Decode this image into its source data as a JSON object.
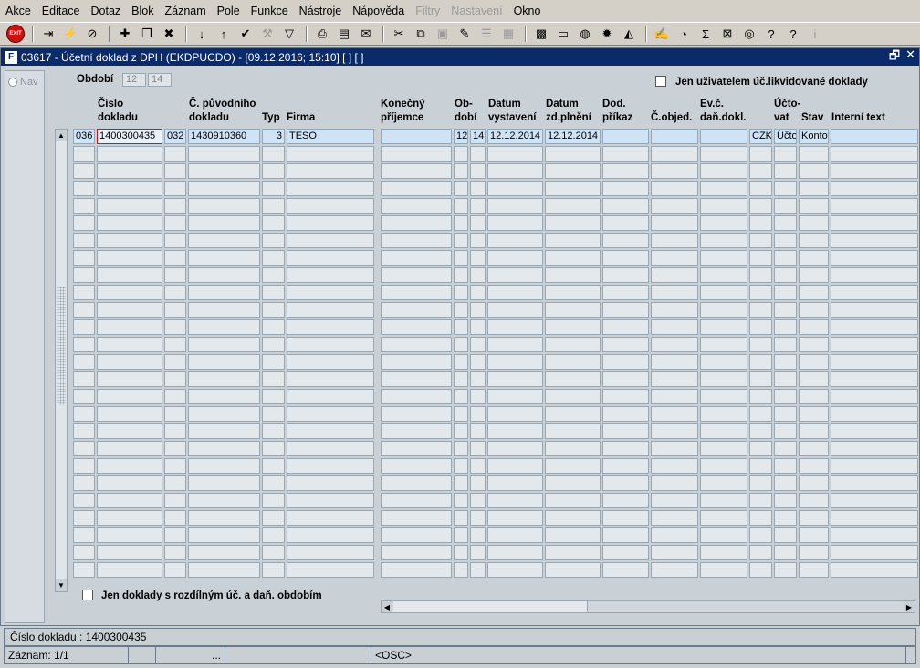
{
  "menu": [
    {
      "label": "Akce",
      "enabled": true
    },
    {
      "label": "Editace",
      "enabled": true
    },
    {
      "label": "Dotaz",
      "enabled": true
    },
    {
      "label": "Blok",
      "enabled": true
    },
    {
      "label": "Záznam",
      "enabled": true
    },
    {
      "label": "Pole",
      "enabled": true
    },
    {
      "label": "Funkce",
      "enabled": true
    },
    {
      "label": "Nástroje",
      "enabled": true
    },
    {
      "label": "Nápověda",
      "enabled": true
    },
    {
      "label": "Filtry",
      "enabled": false
    },
    {
      "label": "Nastavení",
      "enabled": false
    },
    {
      "label": "Okno",
      "enabled": true
    }
  ],
  "toolbar": {
    "exit_label": "EXIT",
    "icons": [
      "exit-icon",
      "sep",
      "enter-query-icon",
      "execute-query-icon",
      "cancel-query-icon",
      "sep",
      "insert-record-icon",
      "duplicate-record-icon",
      "delete-record-icon",
      "sep",
      "sort-asc-icon",
      "sort-desc-icon",
      "save-check-icon",
      "tools-icon",
      "filter-icon",
      "sep",
      "print-icon",
      "print-preview-icon",
      "mail-icon",
      "sep",
      "cut-icon",
      "copy-icon",
      "paste-icon",
      "edit-icon",
      "list-icon",
      "grid-icon",
      "sep",
      "calculator-icon",
      "document-icon",
      "globe-icon",
      "settings-icon",
      "zoom-icon",
      "sep",
      "notes-icon",
      "clock-icon",
      "sum-icon",
      "excel-icon",
      "web-icon",
      "help-question-icon",
      "context-help-icon",
      "info-icon"
    ]
  },
  "window": {
    "title": "03617 - Účetní doklad z DPH (EKDPUCDO) - [09.12.2016; 15:10]  [ ] [ ]",
    "app_icon": "F",
    "restore_glyph": "🗗",
    "close_glyph": "✕"
  },
  "nav": {
    "label": "Nav"
  },
  "filters": {
    "obdobi_label": "Období",
    "obdobi_value1": "12",
    "obdobi_value2": "14",
    "only_liquidated_label": "Jen uživatelem úč.likvidované doklady",
    "different_period_label": "Jen doklady s rozdílným úč. a daň. obdobím"
  },
  "columns": [
    {
      "key": "rada",
      "line1": "",
      "line2": ""
    },
    {
      "key": "cislo",
      "line1": "Číslo",
      "line2": "dokladu"
    },
    {
      "key": "rada2",
      "line1": "",
      "line2": ""
    },
    {
      "key": "puvodni",
      "line1": "Č. původního",
      "line2": "dokladu"
    },
    {
      "key": "typ",
      "line1": "",
      "line2": "Typ"
    },
    {
      "key": "firma",
      "line1": "",
      "line2": "Firma"
    },
    {
      "key": "prijemce",
      "line1": "Konečný",
      "line2": "příjemce"
    },
    {
      "key": "obd1",
      "line1": "Ob-",
      "line2": "dobí"
    },
    {
      "key": "obd2",
      "line1": "",
      "line2": ""
    },
    {
      "key": "vystaveni",
      "line1": "Datum",
      "line2": "vystavení"
    },
    {
      "key": "plneni",
      "line1": "Datum",
      "line2": "zd.plnění"
    },
    {
      "key": "prikaz",
      "line1": "Dod.",
      "line2": "příkaz"
    },
    {
      "key": "objed",
      "line1": "",
      "line2": "Č.objed."
    },
    {
      "key": "evc",
      "line1": "Ev.č.",
      "line2": "daň.dokl."
    },
    {
      "key": "mena",
      "line1": "",
      "line2": ""
    },
    {
      "key": "uctovat",
      "line1": "Účto-",
      "line2": "vat"
    },
    {
      "key": "stav",
      "line1": "",
      "line2": "Stav"
    },
    {
      "key": "interni",
      "line1": "",
      "line2": "Interní text"
    }
  ],
  "rows": [
    {
      "rada": "036",
      "cislo": "1400300435",
      "rada2": "032",
      "puvodni": "1430910360",
      "typ": "3",
      "firma": "TESO",
      "prijemce": "",
      "obd1": "12",
      "obd2": "14",
      "vystaveni": "12.12.2014",
      "plneni": "12.12.2014",
      "prikaz": "",
      "objed": "",
      "evc": "",
      "mena": "CZK",
      "uctovat": "Účto",
      "stav": "Kontov",
      "interni": ""
    }
  ],
  "empty_rows": 25,
  "status": {
    "field_info": "Číslo dokladu : 1400300435",
    "record": "Záznam: 1/1",
    "seg2": "",
    "seg3": "...",
    "seg4": "",
    "mode": "<OSC>"
  }
}
